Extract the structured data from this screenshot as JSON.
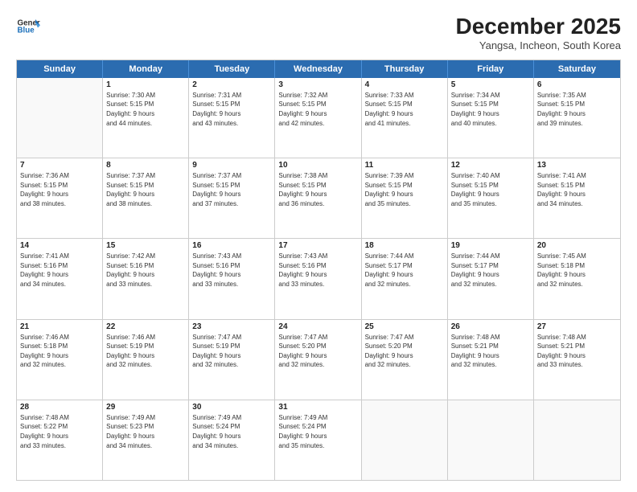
{
  "logo": {
    "line1": "General",
    "line2": "Blue"
  },
  "title": "December 2025",
  "subtitle": "Yangsa, Incheon, South Korea",
  "days": [
    "Sunday",
    "Monday",
    "Tuesday",
    "Wednesday",
    "Thursday",
    "Friday",
    "Saturday"
  ],
  "weeks": [
    [
      {
        "day": "",
        "info": ""
      },
      {
        "day": "1",
        "info": "Sunrise: 7:30 AM\nSunset: 5:15 PM\nDaylight: 9 hours\nand 44 minutes."
      },
      {
        "day": "2",
        "info": "Sunrise: 7:31 AM\nSunset: 5:15 PM\nDaylight: 9 hours\nand 43 minutes."
      },
      {
        "day": "3",
        "info": "Sunrise: 7:32 AM\nSunset: 5:15 PM\nDaylight: 9 hours\nand 42 minutes."
      },
      {
        "day": "4",
        "info": "Sunrise: 7:33 AM\nSunset: 5:15 PM\nDaylight: 9 hours\nand 41 minutes."
      },
      {
        "day": "5",
        "info": "Sunrise: 7:34 AM\nSunset: 5:15 PM\nDaylight: 9 hours\nand 40 minutes."
      },
      {
        "day": "6",
        "info": "Sunrise: 7:35 AM\nSunset: 5:15 PM\nDaylight: 9 hours\nand 39 minutes."
      }
    ],
    [
      {
        "day": "7",
        "info": "Sunrise: 7:36 AM\nSunset: 5:15 PM\nDaylight: 9 hours\nand 38 minutes."
      },
      {
        "day": "8",
        "info": "Sunrise: 7:37 AM\nSunset: 5:15 PM\nDaylight: 9 hours\nand 38 minutes."
      },
      {
        "day": "9",
        "info": "Sunrise: 7:37 AM\nSunset: 5:15 PM\nDaylight: 9 hours\nand 37 minutes."
      },
      {
        "day": "10",
        "info": "Sunrise: 7:38 AM\nSunset: 5:15 PM\nDaylight: 9 hours\nand 36 minutes."
      },
      {
        "day": "11",
        "info": "Sunrise: 7:39 AM\nSunset: 5:15 PM\nDaylight: 9 hours\nand 35 minutes."
      },
      {
        "day": "12",
        "info": "Sunrise: 7:40 AM\nSunset: 5:15 PM\nDaylight: 9 hours\nand 35 minutes."
      },
      {
        "day": "13",
        "info": "Sunrise: 7:41 AM\nSunset: 5:15 PM\nDaylight: 9 hours\nand 34 minutes."
      }
    ],
    [
      {
        "day": "14",
        "info": "Sunrise: 7:41 AM\nSunset: 5:16 PM\nDaylight: 9 hours\nand 34 minutes."
      },
      {
        "day": "15",
        "info": "Sunrise: 7:42 AM\nSunset: 5:16 PM\nDaylight: 9 hours\nand 33 minutes."
      },
      {
        "day": "16",
        "info": "Sunrise: 7:43 AM\nSunset: 5:16 PM\nDaylight: 9 hours\nand 33 minutes."
      },
      {
        "day": "17",
        "info": "Sunrise: 7:43 AM\nSunset: 5:16 PM\nDaylight: 9 hours\nand 33 minutes."
      },
      {
        "day": "18",
        "info": "Sunrise: 7:44 AM\nSunset: 5:17 PM\nDaylight: 9 hours\nand 32 minutes."
      },
      {
        "day": "19",
        "info": "Sunrise: 7:44 AM\nSunset: 5:17 PM\nDaylight: 9 hours\nand 32 minutes."
      },
      {
        "day": "20",
        "info": "Sunrise: 7:45 AM\nSunset: 5:18 PM\nDaylight: 9 hours\nand 32 minutes."
      }
    ],
    [
      {
        "day": "21",
        "info": "Sunrise: 7:46 AM\nSunset: 5:18 PM\nDaylight: 9 hours\nand 32 minutes."
      },
      {
        "day": "22",
        "info": "Sunrise: 7:46 AM\nSunset: 5:19 PM\nDaylight: 9 hours\nand 32 minutes."
      },
      {
        "day": "23",
        "info": "Sunrise: 7:47 AM\nSunset: 5:19 PM\nDaylight: 9 hours\nand 32 minutes."
      },
      {
        "day": "24",
        "info": "Sunrise: 7:47 AM\nSunset: 5:20 PM\nDaylight: 9 hours\nand 32 minutes."
      },
      {
        "day": "25",
        "info": "Sunrise: 7:47 AM\nSunset: 5:20 PM\nDaylight: 9 hours\nand 32 minutes."
      },
      {
        "day": "26",
        "info": "Sunrise: 7:48 AM\nSunset: 5:21 PM\nDaylight: 9 hours\nand 32 minutes."
      },
      {
        "day": "27",
        "info": "Sunrise: 7:48 AM\nSunset: 5:21 PM\nDaylight: 9 hours\nand 33 minutes."
      }
    ],
    [
      {
        "day": "28",
        "info": "Sunrise: 7:48 AM\nSunset: 5:22 PM\nDaylight: 9 hours\nand 33 minutes."
      },
      {
        "day": "29",
        "info": "Sunrise: 7:49 AM\nSunset: 5:23 PM\nDaylight: 9 hours\nand 34 minutes."
      },
      {
        "day": "30",
        "info": "Sunrise: 7:49 AM\nSunset: 5:24 PM\nDaylight: 9 hours\nand 34 minutes."
      },
      {
        "day": "31",
        "info": "Sunrise: 7:49 AM\nSunset: 5:24 PM\nDaylight: 9 hours\nand 35 minutes."
      },
      {
        "day": "",
        "info": ""
      },
      {
        "day": "",
        "info": ""
      },
      {
        "day": "",
        "info": ""
      }
    ]
  ]
}
